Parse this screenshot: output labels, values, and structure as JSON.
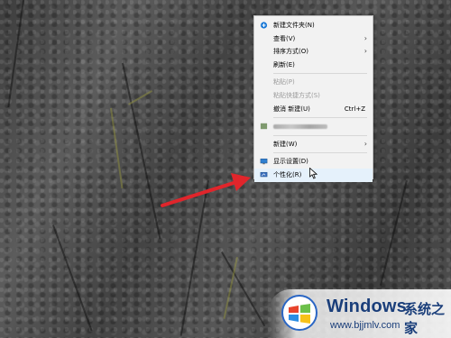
{
  "context_menu": {
    "items": [
      {
        "label": "新建文件夹(N)"
      },
      {
        "label": "查看(V)"
      },
      {
        "label": "排序方式(O)"
      },
      {
        "label": "刷新(E)"
      },
      {
        "label": "粘贴(P)"
      },
      {
        "label": "粘贴快捷方式(S)"
      },
      {
        "label": "撤消 新建(U)",
        "shortcut": "Ctrl+Z"
      },
      {
        "label": "新建(W)"
      },
      {
        "label": "显示设置(D)"
      },
      {
        "label": "个性化(R)"
      }
    ],
    "icons": [
      "new-folder-icon",
      "chevron-right-icon",
      "display-settings-icon",
      "personalize-icon"
    ]
  },
  "watermark": {
    "brand": "Windows",
    "brand_cn": "系统之家",
    "url": "www.bjjmlv.com"
  },
  "colors": {
    "arrow": "#e0252b",
    "brand_blue": "#1a3e7a",
    "menu_background": "#f2f2f2",
    "hover_background": "#e5f1fb"
  }
}
